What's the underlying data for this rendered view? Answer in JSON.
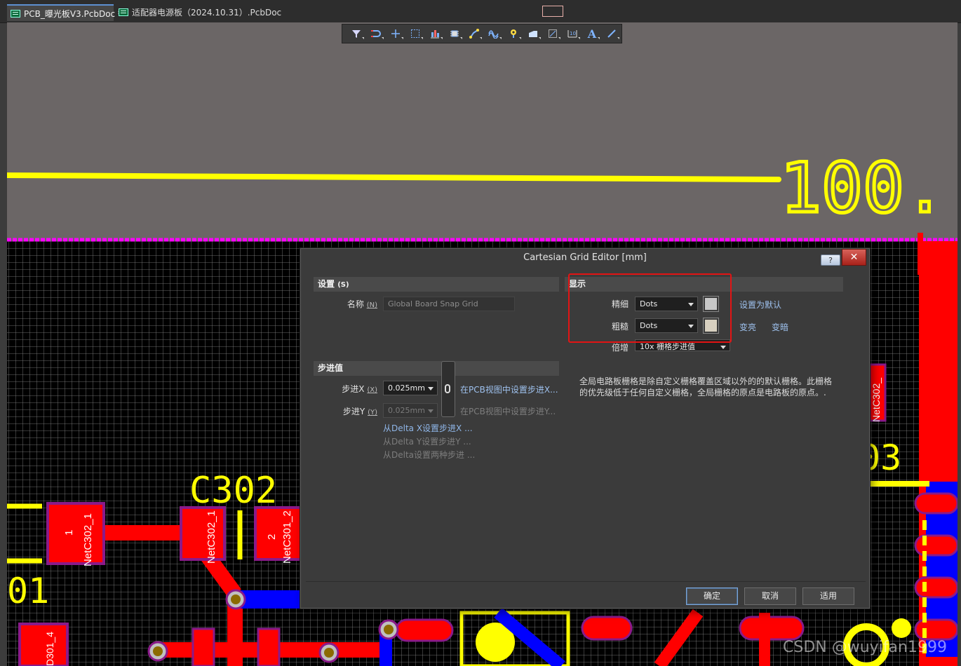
{
  "tabs": [
    {
      "label": "PCB_曝光板V3.PcbDoc *",
      "active": true
    },
    {
      "label": "适配器电源板（2024.10.31）.PcbDoc",
      "active": false
    }
  ],
  "toolbar": {
    "icons": [
      "filter-icon",
      "route-icon",
      "crosshair-icon",
      "select-icon",
      "align-icon",
      "component-icon",
      "interactive-route-icon",
      "diff-pair-icon",
      "via-icon",
      "fill-icon",
      "region-icon",
      "dimension-icon",
      "text-icon",
      "line-icon"
    ],
    "text_glyph": "A"
  },
  "canvas": {
    "dimension_text": "100.",
    "designators": [
      "C302",
      "01",
      "03"
    ],
    "pad_labels": {
      "c302_1_num": "1",
      "c302_1_net": "NetC302_1",
      "c302_2_net": "NetC302_1",
      "c301_2_num": "2",
      "c301_2_net": "NetC301_2",
      "d301_4": "D301_4",
      "right_net": "NetC302_"
    },
    "colors": {
      "top_layer": "#ff0000",
      "bottom_layer": "#0000ff",
      "overlay": "#ffff00",
      "keepout": "#ff00ff",
      "grid": "#8a8a8a",
      "board": "#000000",
      "outside": "#6b6666",
      "pad_border": "#8a1a8a",
      "via_ring": "#c0c0c0",
      "via_hole": "#8b6a00"
    }
  },
  "dialog": {
    "title": "Cartesian Grid Editor [mm]",
    "help_label": "?",
    "close_label": "✕",
    "settings": {
      "header": "设置",
      "header_key": "(S)",
      "name_label": "名称",
      "name_key": "(N)",
      "name_value": "Global Board Snap Grid"
    },
    "step": {
      "header": "步进值",
      "step_x_label": "步进X",
      "step_x_key": "(X)",
      "step_x_value": "0.025mm",
      "step_y_label": "步进Y",
      "step_y_key": "(Y)",
      "step_y_value": "0.025mm",
      "set_x_from_view": "在PCB视图中设置步进X...",
      "set_y_from_view": "在PCB视图中设置步进Y...",
      "from_delta_x": "从Delta X设置步进X ...",
      "from_delta_y": "从Delta Y设置步进Y ...",
      "from_delta_both": "从Delta设置两种步进 ..."
    },
    "display": {
      "header": "显示",
      "fine_label": "精细",
      "fine_value": "Dots",
      "fine_color": "#c8c8c8",
      "coarse_label": "粗糙",
      "coarse_value": "Dots",
      "coarse_color": "#d8d0c0",
      "multiplier_label": "倍增",
      "multiplier_value": "10x 栅格步进值",
      "set_default": "设置为默认",
      "lighter": "变亮",
      "darker": "变暗"
    },
    "description": "全局电路板栅格是除自定义栅格覆盖区域以外的的默认栅格。此栅格的优先级低于任何自定义栅格，全局栅格的原点是电路板的原点。.",
    "buttons": {
      "ok": "确定",
      "cancel": "取消",
      "apply": "适用"
    }
  },
  "highlight_color": "#e31414",
  "watermark": "CSDN @wuyifan1999"
}
